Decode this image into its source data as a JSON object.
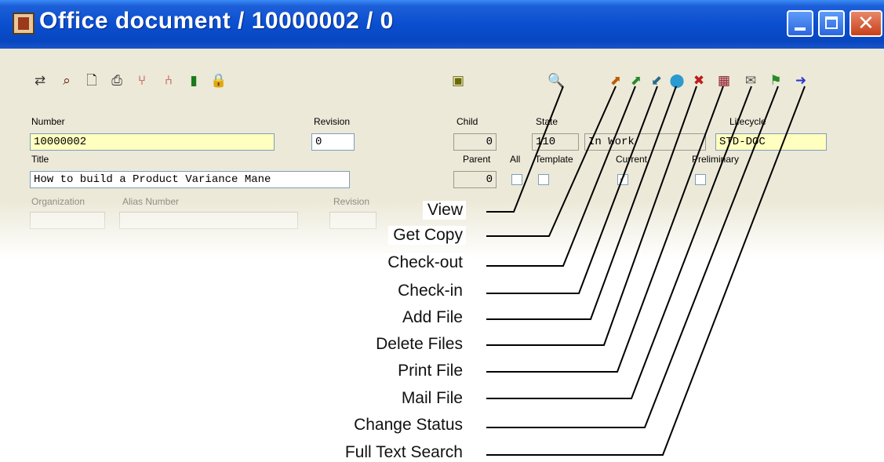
{
  "window": {
    "title": "Office document / 10000002 / 0",
    "controls": {
      "minimize": "minimize",
      "maximize": "maximize",
      "close": "✕"
    }
  },
  "toolbar_left": [
    {
      "icon": "refresh-icon",
      "glyph": "⇄",
      "color": "#3a3a3a"
    },
    {
      "icon": "binoculars-search-icon",
      "glyph": "⌕",
      "color": "#5a1a00"
    },
    {
      "icon": "new-document-icon",
      "glyph": "🗋",
      "color": "#222222"
    },
    {
      "icon": "printer-icon",
      "glyph": "⎙",
      "color": "#333333"
    },
    {
      "icon": "structure-icon",
      "glyph": "⑂",
      "color": "#b01010"
    },
    {
      "icon": "link-structure-icon",
      "glyph": "⑃",
      "color": "#b01010"
    },
    {
      "icon": "trash-icon",
      "glyph": "▮",
      "color": "#1a7a1a"
    },
    {
      "icon": "lock-icon",
      "glyph": "🔒",
      "color": "#1a7a1a"
    }
  ],
  "toolbar_right": [
    {
      "icon": "folder-icon",
      "glyph": "▣",
      "color": "#6a6a00"
    },
    {
      "icon": "view-icon",
      "glyph": "🔍",
      "color": "#222222"
    },
    {
      "icon": "get-copy-icon",
      "glyph": "⬈",
      "color": "#c05a00"
    },
    {
      "icon": "check-out-icon",
      "glyph": "⬈",
      "color": "#2a8a2a"
    },
    {
      "icon": "check-in-icon",
      "glyph": "⬋",
      "color": "#2a6a8a"
    },
    {
      "icon": "add-file-icon",
      "glyph": "⬤",
      "color": "#2a9ad0"
    },
    {
      "icon": "delete-files-icon",
      "glyph": "✖",
      "color": "#c01a1a"
    },
    {
      "icon": "print-file-icon",
      "glyph": "▦",
      "color": "#8a1a2a"
    },
    {
      "icon": "mail-file-icon",
      "glyph": "✉",
      "color": "#555555"
    },
    {
      "icon": "change-status-icon",
      "glyph": "⚑",
      "color": "#2a8a2a"
    },
    {
      "icon": "full-text-search-icon",
      "glyph": "➜",
      "color": "#2a3ad0"
    }
  ],
  "form": {
    "number_label": "Number",
    "number_value": "10000002",
    "revision_label": "Revision",
    "revision_value": "0",
    "child_label": "Child",
    "child_value": "0",
    "state_label": "State",
    "state_code": "110",
    "state_text": "In Work",
    "lifecycle_label": "Lifecycle",
    "lifecycle_value": "STD-DOC",
    "title_label": "Title",
    "title_value": "How to build a Product Variance Mane",
    "parent_label": "Parent",
    "parent_value": "0",
    "all_label": "All",
    "template_label": "Template",
    "current_label": "Current",
    "preliminary_label": "Preliminary",
    "organization_label": "Organization",
    "alias_number_label": "Alias Number",
    "revision2_label": "Revision"
  },
  "callouts": [
    "View",
    "Get Copy",
    "Check-out",
    "Check-in",
    "Add File",
    "Delete Files",
    "Print File",
    "Mail File",
    "Change Status",
    "Full Text Search"
  ]
}
